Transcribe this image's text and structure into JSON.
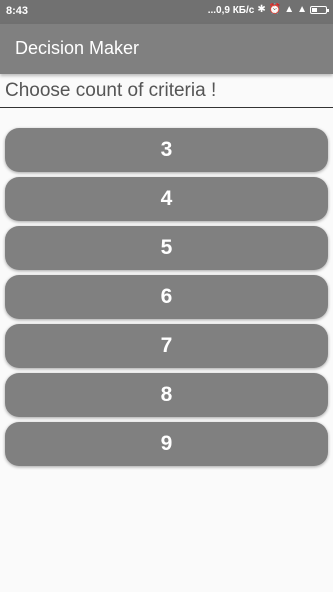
{
  "status_bar": {
    "time": "8:43",
    "indicators": "...0,9 КБ/с",
    "icons": [
      "bluetooth-icon",
      "alarm-icon",
      "signal-icon",
      "signal-icon",
      "battery-icon"
    ]
  },
  "app_bar": {
    "title": "Decision Maker"
  },
  "prompt": {
    "text": "Choose count of criteria !"
  },
  "buttons": [
    {
      "label": "3"
    },
    {
      "label": "4"
    },
    {
      "label": "5"
    },
    {
      "label": "6"
    },
    {
      "label": "7"
    },
    {
      "label": "8"
    },
    {
      "label": "9"
    }
  ],
  "colors": {
    "status_bar": "#717171",
    "app_bar": "#808080",
    "button": "#808080",
    "background": "#fafafa"
  }
}
